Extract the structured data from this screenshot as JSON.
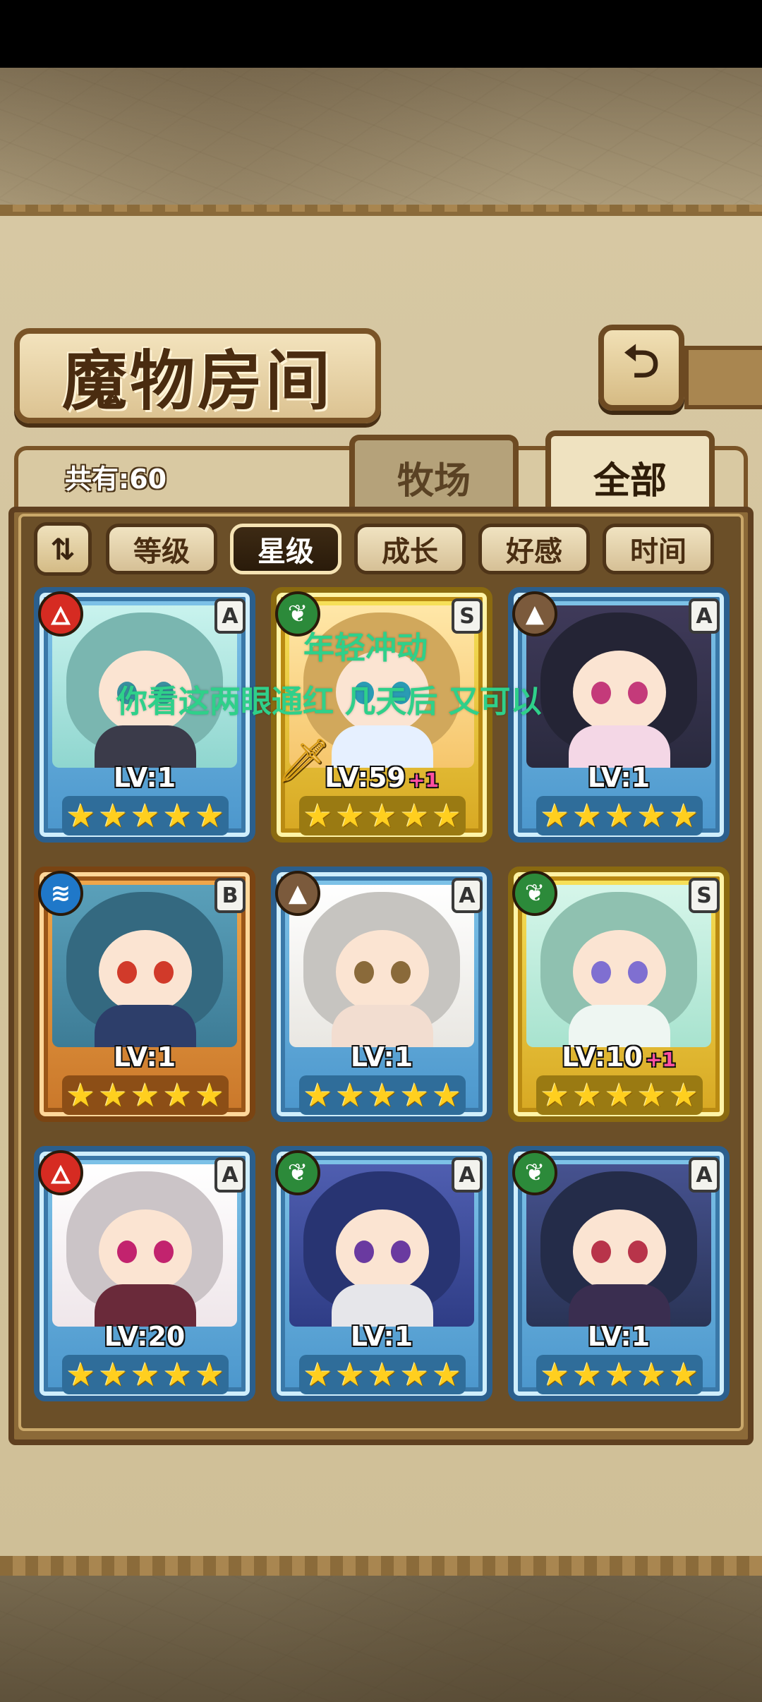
{
  "header": {
    "title": "魔物房间",
    "back_icon": "return-arrow-icon",
    "back_glyph": "⮌"
  },
  "tabs": {
    "count_label": "共有:60",
    "ranch_label": "牧场",
    "all_label": "全部"
  },
  "sort": {
    "toggle_glyph": "⇅",
    "buttons": [
      "等级",
      "星级",
      "成长",
      "好感",
      "时间"
    ],
    "active": "星级"
  },
  "cards": [
    {
      "element": "fire",
      "grade": "A",
      "level": "LV:1",
      "plus": "",
      "stars": 5,
      "frame": "blue"
    },
    {
      "element": "leaf",
      "grade": "S",
      "level": "LV:59",
      "plus": "+1",
      "stars": 5,
      "frame": "gold"
    },
    {
      "element": "earth",
      "grade": "A",
      "level": "LV:1",
      "plus": "",
      "stars": 5,
      "frame": "blue"
    },
    {
      "element": "water",
      "grade": "B",
      "level": "LV:1",
      "plus": "",
      "stars": 5,
      "frame": "orange"
    },
    {
      "element": "earth",
      "grade": "A",
      "level": "LV:1",
      "plus": "",
      "stars": 5,
      "frame": "blue"
    },
    {
      "element": "leaf",
      "grade": "S",
      "level": "LV:10",
      "plus": "+1",
      "stars": 5,
      "frame": "gold"
    },
    {
      "element": "fire",
      "grade": "A",
      "level": "LV:20",
      "plus": "",
      "stars": 5,
      "frame": "blue"
    },
    {
      "element": "leaf",
      "grade": "A",
      "level": "LV:1",
      "plus": "",
      "stars": 5,
      "frame": "blue"
    },
    {
      "element": "leaf",
      "grade": "A",
      "level": "LV:1",
      "plus": "",
      "stars": 5,
      "frame": "blue"
    }
  ],
  "overlay": {
    "line1": "年轻冲动",
    "line2": "你看这两眼通红 几天后 又可以"
  },
  "colors": {
    "overlay_text": "#2fd08a",
    "fire": "#d62b22",
    "leaf": "#2c8a3a",
    "earth": "#7b5a3c",
    "water": "#1f78c9",
    "star": "#ffcf1f"
  }
}
